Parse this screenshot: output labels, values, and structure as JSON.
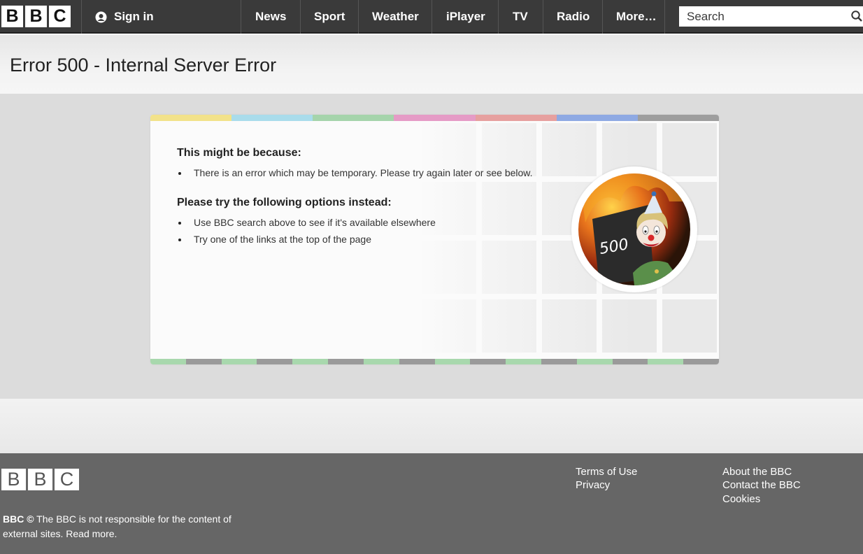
{
  "header": {
    "logo_letters": [
      "B",
      "B",
      "C"
    ],
    "signin_label": "Sign in",
    "nav": [
      "News",
      "Sport",
      "Weather",
      "iPlayer",
      "TV",
      "Radio",
      "More…"
    ],
    "search_placeholder": "Search"
  },
  "page_title": "Error 500 - Internal Server Error",
  "card": {
    "reason_heading": "This might be because:",
    "reason_items": [
      "There is an error which may be temporary. Please try again later or see below."
    ],
    "options_heading": "Please try the following options instead:",
    "options_items": [
      "Use BBC search above to see if it's available elsewhere",
      "Try one of the links at the top of the page"
    ],
    "illustration_text": "500",
    "top_stripe_colors": [
      "#f2e28a",
      "#a9dceb",
      "#a5d4ab",
      "#e59bc6",
      "#e6a09f",
      "#8ea9e3",
      "#9e9e9e"
    ],
    "bottom_stripe_colors": [
      "#a8d8ad",
      "#9a9a9a"
    ]
  },
  "footer": {
    "logo_letters": [
      "B",
      "B",
      "C"
    ],
    "links_col1": [
      "Terms of Use",
      "Privacy"
    ],
    "links_col2": [
      "About the BBC",
      "Contact the BBC",
      "Cookies"
    ],
    "note_brand": "BBC ©",
    "note_text": " The BBC is not responsible for the content of external sites. Read more."
  },
  "colors": {
    "topbar": "#3a3a3a",
    "main_grey": "#dcdcdc",
    "footer": "#666666"
  }
}
